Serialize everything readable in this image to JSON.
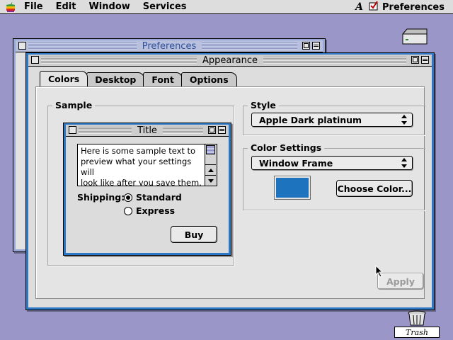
{
  "menubar": {
    "items": [
      "File",
      "Edit",
      "Window",
      "Services"
    ],
    "active_app": "Preferences"
  },
  "desktop": {
    "trash_label": "Trash"
  },
  "windows": {
    "back_title": "Preferences",
    "front_title": "Appearance"
  },
  "tabs": [
    "Colors",
    "Desktop",
    "Font",
    "Options"
  ],
  "active_tab": "Colors",
  "sample": {
    "group_label": "Sample",
    "window_title": "Title",
    "text": "Here is some sample text to\npreview what your settings will\nlook like after you save them.\nHere is some sample text to",
    "shipping_label": "Shipping:",
    "options": [
      "Standard",
      "Express"
    ],
    "selected_option": "Standard",
    "button_label": "Buy"
  },
  "style": {
    "group_label": "Style",
    "selected_value": "Apple Dark platinum"
  },
  "color_settings": {
    "group_label": "Color Settings",
    "selected_value": "Window Frame",
    "swatch_color": "#1e73be",
    "choose_button_label": "Choose Color..."
  },
  "apply_button_label": "Apply",
  "colors": {
    "window_frame": "#2d78c6",
    "desktop": "#9a97c8"
  }
}
